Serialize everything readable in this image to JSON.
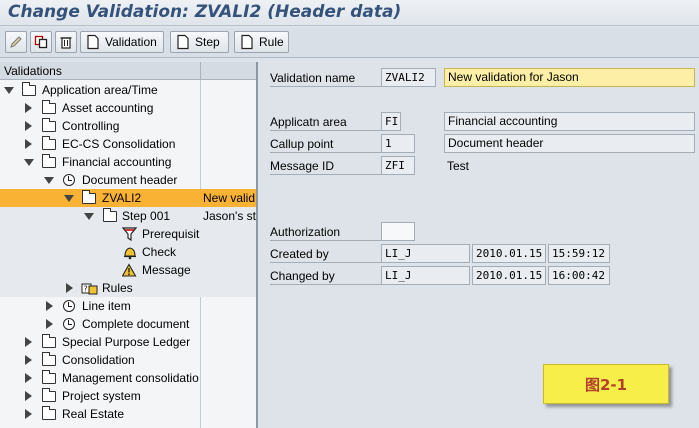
{
  "window": {
    "title": "Change Validation: ZVALI2 (Header data)"
  },
  "toolbar": {
    "validation_label": "Validation",
    "step_label": "Step",
    "rule_label": "Rule",
    "icons": [
      "pencil-icon",
      "copy-icon",
      "trash-icon",
      "document-icon"
    ]
  },
  "tree": {
    "header": "Validations",
    "rows": [
      {
        "label": "Application area/Time",
        "col2": ""
      },
      {
        "label": "Asset accounting",
        "col2": ""
      },
      {
        "label": "Controlling",
        "col2": ""
      },
      {
        "label": "EC-CS Consolidation",
        "col2": ""
      },
      {
        "label": "Financial accounting",
        "col2": ""
      },
      {
        "label": "Document header",
        "col2": ""
      },
      {
        "label": "ZVALI2",
        "col2": "New valid"
      },
      {
        "label": "Step 001",
        "col2": "Jason's st"
      },
      {
        "label": "Prerequisit",
        "col2": ""
      },
      {
        "label": "Check",
        "col2": ""
      },
      {
        "label": "Message",
        "col2": ""
      },
      {
        "label": "Rules",
        "col2": ""
      },
      {
        "label": "Line item",
        "col2": ""
      },
      {
        "label": "Complete document",
        "col2": ""
      },
      {
        "label": "Special Purpose Ledger",
        "col2": ""
      },
      {
        "label": "Consolidation",
        "col2": ""
      },
      {
        "label": "Management consolidatio",
        "col2": ""
      },
      {
        "label": "Project system",
        "col2": ""
      },
      {
        "label": "Real Estate",
        "col2": ""
      }
    ]
  },
  "form": {
    "validation_name_label": "Validation name",
    "validation_name": "ZVALI2",
    "validation_desc": "New validation for Jason",
    "appl_area_label": "Applicatn area",
    "appl_area": "FI",
    "appl_area_desc": "Financial accounting",
    "callup_label": "Callup point",
    "callup": "1",
    "callup_desc": "Document header",
    "message_id_label": "Message ID",
    "message_id": "ZFI",
    "message_id_desc": "Test",
    "authorization_label": "Authorization",
    "authorization": "",
    "created_by_label": "Created by",
    "created_by": "LI_J",
    "created_date": "2010.01.15",
    "created_time": "15:59:12",
    "changed_by_label": "Changed by",
    "changed_by": "LI_J",
    "changed_date": "2010.01.15",
    "changed_time": "16:00:42"
  },
  "figure_label": "图2-1",
  "colors": {
    "selected": "#f9b233",
    "title": "#35537a",
    "highlight_field": "#fdf0a6",
    "badge": "#f7ee4a"
  }
}
